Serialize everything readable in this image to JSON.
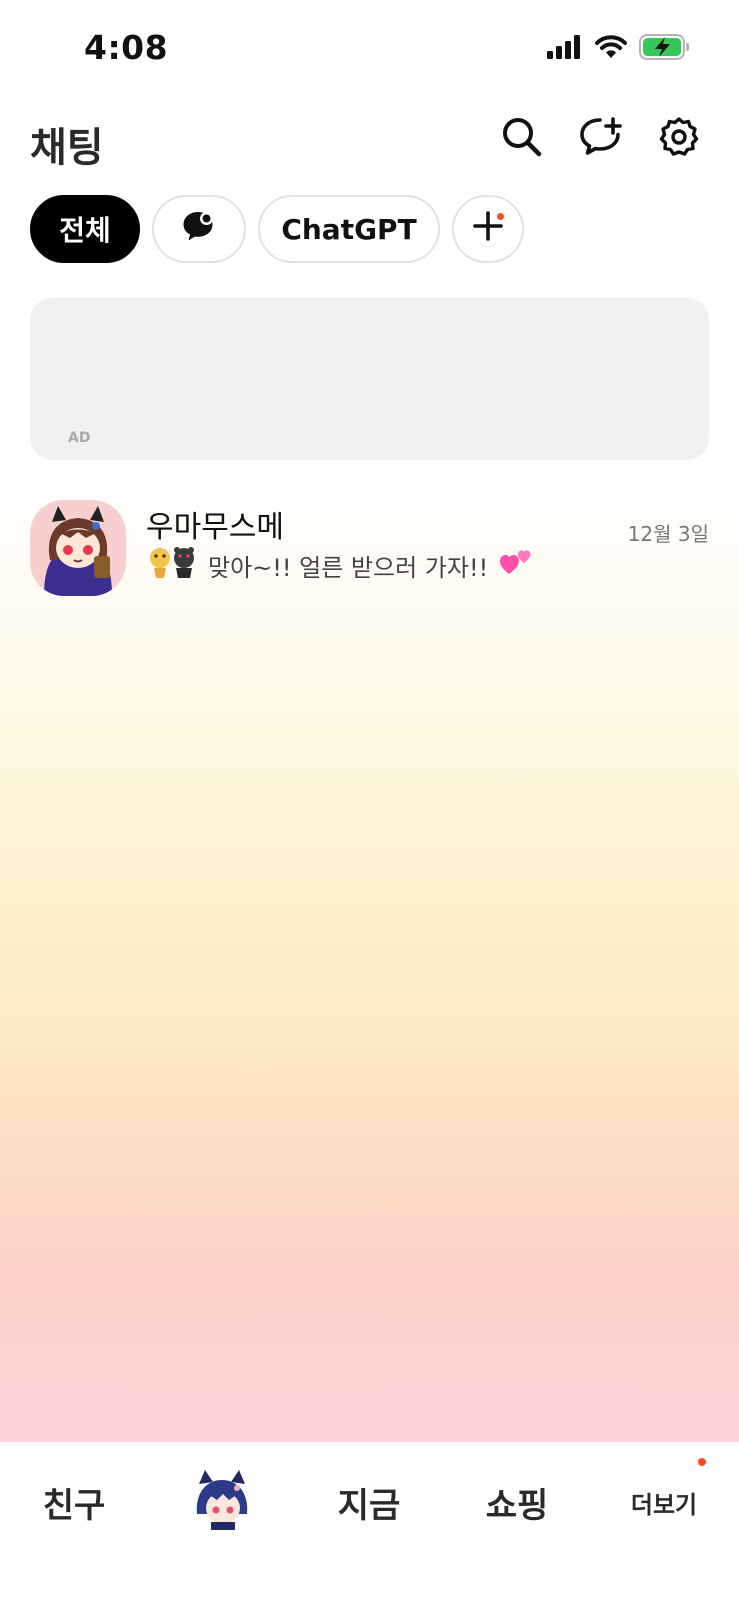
{
  "status_bar": {
    "time": "4:08",
    "icons": [
      "signal-icon",
      "wifi-icon",
      "battery-charging-icon"
    ],
    "battery_color": "#34c759"
  },
  "header": {
    "title": "채팅",
    "buttons": [
      "search-icon",
      "new-chat-icon",
      "settings-icon"
    ]
  },
  "filters": [
    {
      "label": "전체",
      "active": true
    },
    {
      "label": "",
      "icon": "chat-bubble-icon",
      "active": false
    },
    {
      "label": "ChatGPT",
      "active": false
    },
    {
      "label": "",
      "icon": "plus-icon",
      "active": false,
      "has_badge": true
    }
  ],
  "ad": {
    "label": "AD"
  },
  "chats": [
    {
      "name": "우마무스메",
      "date": "12월 3일",
      "preview_prefix_icon": "sticker-icon",
      "preview": "맞아~!! 얼른 받으러 가자!!",
      "preview_suffix_icon": "hearts-emoji"
    }
  ],
  "tab_bar": {
    "tabs": [
      {
        "label": "친구"
      },
      {
        "label": "",
        "icon": "character-avatar-icon"
      },
      {
        "label": "지금"
      },
      {
        "label": "쇼핑"
      },
      {
        "label": "더보기",
        "has_badge": true
      }
    ]
  },
  "colors": {
    "accent": "#000000",
    "badge": "#ff4b1f"
  }
}
